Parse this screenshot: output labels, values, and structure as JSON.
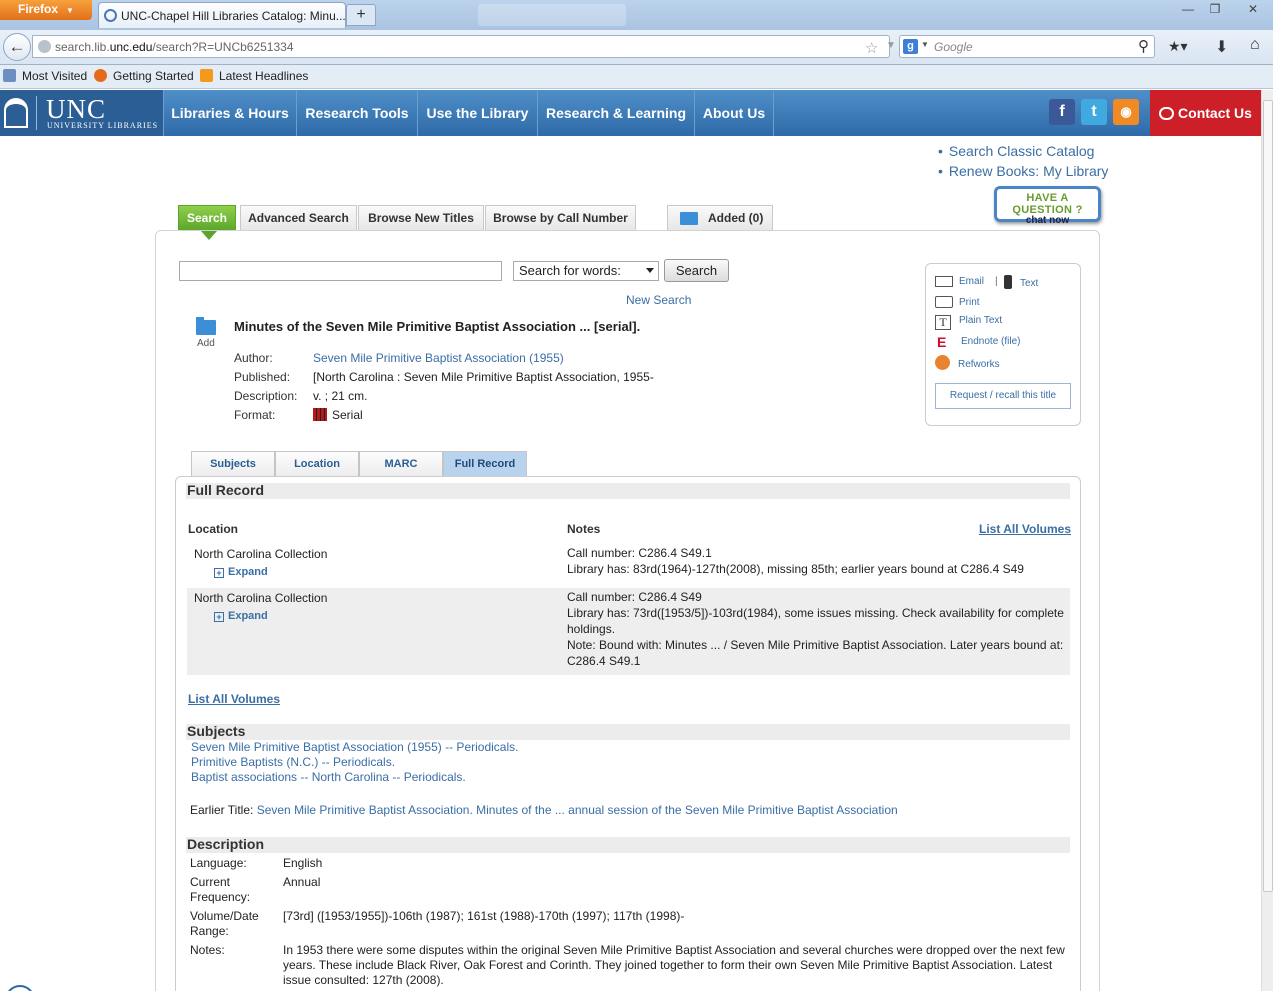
{
  "browser": {
    "app_button": "Firefox",
    "tab_title": "UNC-Chapel Hill Libraries Catalog: Minu...",
    "url_prefix": "search.lib.",
    "url_domain": "unc.edu",
    "url_suffix": "/search?R=UNCb6251334",
    "search_placeholder": "Google",
    "bookmarks": [
      "Most Visited",
      "Getting Started",
      "Latest Headlines"
    ]
  },
  "site": {
    "logo_big": "UNC",
    "logo_small": "UNIVERSITY LIBRARIES",
    "nav": [
      "Libraries & Hours",
      "Research Tools",
      "Use the Library",
      "Research & Learning",
      "About Us"
    ],
    "contact": "Contact Us",
    "quick_links": [
      "Search Classic Catalog",
      "Renew Books: My Library"
    ],
    "chat_line1": "HAVE A QUESTION ?",
    "chat_line2": "chat now"
  },
  "catalog_tabs": {
    "search": "Search",
    "advanced": "Advanced Search",
    "browse_new": "Browse New Titles",
    "browse_call": "Browse by Call Number",
    "added": "Added (0)"
  },
  "search": {
    "query": "",
    "select_value": "Search for words:",
    "button": "Search",
    "new_search": "New Search"
  },
  "record": {
    "add_label": "Add",
    "title": "Minutes of the Seven Mile Primitive Baptist Association ... [serial].",
    "labels": [
      "Author:",
      "Published:",
      "Description:",
      "Format:"
    ],
    "author": "Seven Mile Primitive Baptist Association (1955)",
    "published": "[North Carolina : Seven Mile Primitive Baptist Association, 1955-",
    "description": "v. ; 21 cm.",
    "format": "Serial"
  },
  "tools": {
    "email": "Email",
    "separator": "|",
    "text": "Text",
    "print": "Print",
    "plain": "Plain Text",
    "endnote": "Endnote (file)",
    "refworks": "Refworks",
    "request": "Request / recall this title"
  },
  "record_tabs": [
    "Subjects",
    "Location",
    "MARC",
    "Full Record"
  ],
  "full_record": {
    "heading": "Full Record",
    "col_location": "Location",
    "col_notes": "Notes",
    "list_all": "List All Volumes",
    "expand": "Expand",
    "holdings": [
      {
        "location": "North Carolina Collection",
        "notes": [
          "Call number: C286.4 S49.1",
          "Library has: 83rd(1964)-127th(2008), missing 85th; earlier years bound at C286.4 S49"
        ]
      },
      {
        "location": "North Carolina Collection",
        "notes": [
          "Call number: C286.4 S49",
          "Library has: 73rd([1953/5])-103rd(1984), some issues missing. Check availability for complete holdings.",
          "Note: Bound with: Minutes ... / Seven Mile Primitive Baptist Association. Later years bound at: C286.4 S49.1"
        ]
      }
    ]
  },
  "subjects": {
    "heading": "Subjects",
    "items": [
      "Seven Mile Primitive Baptist Association (1955) -- Periodicals.",
      "Primitive Baptists (N.C.) -- Periodicals.",
      "Baptist associations -- North Carolina -- Periodicals."
    ],
    "earlier_label": "Earlier Title:",
    "earlier_value": "Seven Mile Primitive Baptist Association. Minutes of the ... annual session of the Seven Mile Primitive Baptist Association"
  },
  "description": {
    "heading": "Description",
    "rows": [
      {
        "label": "Language:",
        "value": "English"
      },
      {
        "label": "Current Frequency:",
        "value": "Annual"
      },
      {
        "label": "Volume/Date Range:",
        "value": "[73rd] ([1953/1955])-106th (1987); 161st (1988)-170th (1997); 117th (1998)-"
      },
      {
        "label": "Notes:",
        "value": "In 1953 there were some disputes within the original Seven Mile Primitive Baptist Association and several churches were dropped over the next few years. These include Black River, Oak Forest and Corinth. They joined together to form their own Seven Mile Primitive Baptist Association. Latest issue consulted: 127th (2008)."
      }
    ]
  }
}
